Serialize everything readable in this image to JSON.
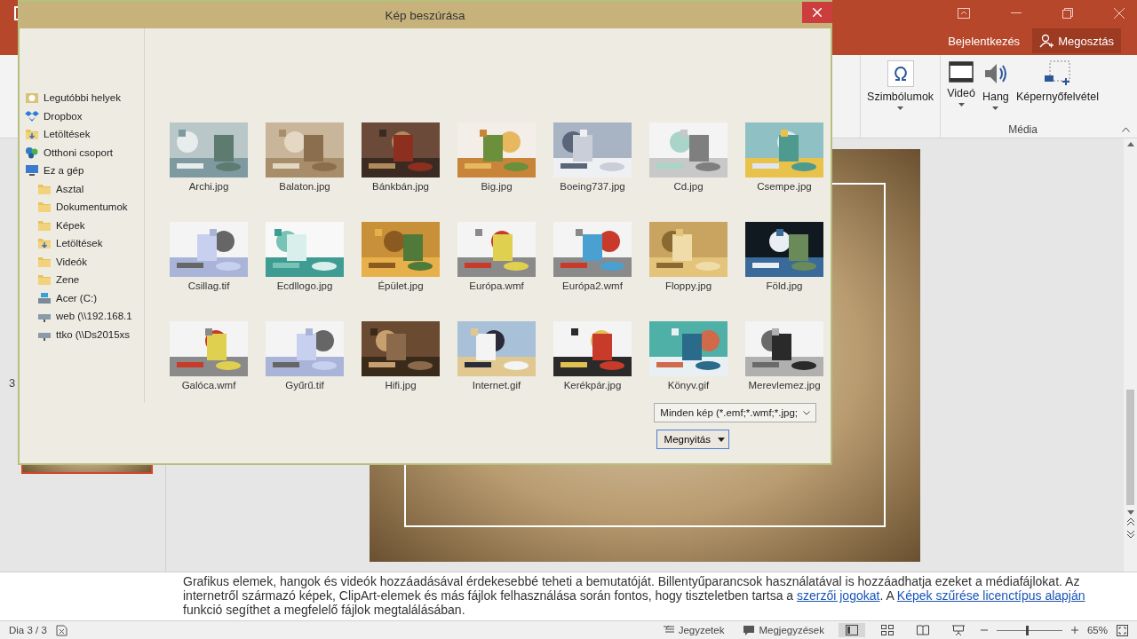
{
  "header": {
    "signin": "Bejelentkezés",
    "share": "Megosztás"
  },
  "ribbon": {
    "groups": [
      {
        "buttons": [
          {
            "label": "Szimbólumok",
            "kind": "symbol",
            "dropdown": true
          }
        ]
      },
      {
        "label": "Média",
        "buttons": [
          {
            "label": "Videó",
            "kind": "video",
            "dropdown": true
          },
          {
            "label": "Hang",
            "kind": "audio",
            "dropdown": true
          },
          {
            "label": "Képernyőfelvétel",
            "kind": "screen",
            "dropdown": false
          }
        ]
      }
    ]
  },
  "thumbnails": [
    {
      "number": "3",
      "selected": true
    }
  ],
  "notes": [
    {
      "text": "Grafikus elemek, hangok és videók hozzáadásával érdekesebbé teheti a bemutatóját. Billentyűparancsok használatával is hozzáadhatja ezeket a médiafájlokat. Az internetről származó képek, ClipArt-elemek és más fájlok felhasználása során fontos, hogy tiszteletben tartsa a ",
      "link": false
    },
    {
      "text": "szerzői jogokat",
      "link": true
    },
    {
      "text": ". A ",
      "link": false
    },
    {
      "text": "Képek szűrése licenctípus alapján",
      "link": true
    },
    {
      "text": " funkció segíthet a megfelelő fájlok megtalálásában.",
      "link": false
    }
  ],
  "status": {
    "slide": "Dia 3 / 3",
    "notes": "Jegyzetek",
    "comments": "Megjegyzések",
    "zoom": {
      "reading": "65%",
      "level": 0.45
    }
  },
  "dialog": {
    "title": "Kép beszúrása",
    "nav": [
      {
        "label": "Legutóbbi helyek",
        "kind": "recent"
      },
      {
        "label": "Dropbox",
        "kind": "dropbox"
      },
      {
        "label": "Letöltések",
        "kind": "download"
      },
      {
        "label": "Otthoni csoport",
        "kind": "homegroup"
      },
      {
        "label": "Ez a gép",
        "kind": "computer",
        "children": [
          {
            "label": "Asztal",
            "kind": "folder"
          },
          {
            "label": "Dokumentumok",
            "kind": "folder"
          },
          {
            "label": "Képek",
            "kind": "folder"
          },
          {
            "label": "Letöltések",
            "kind": "download"
          },
          {
            "label": "Videók",
            "kind": "folder"
          },
          {
            "label": "Zene",
            "kind": "folder"
          },
          {
            "label": "Acer (C:)",
            "kind": "drive"
          },
          {
            "label": "web (\\\\192.168.1",
            "kind": "network"
          },
          {
            "label": "ttko (\\\\Ds2015xs",
            "kind": "network"
          }
        ]
      }
    ],
    "files": [
      {
        "name": "Archi.jpg"
      },
      {
        "name": "Balaton.jpg"
      },
      {
        "name": "Bánkbán.jpg"
      },
      {
        "name": "Big.jpg"
      },
      {
        "name": "Boeing737.jpg"
      },
      {
        "name": "Cd.jpg"
      },
      {
        "name": "Csempe.jpg"
      },
      {
        "name": "Csillag.tif"
      },
      {
        "name": "Ecdllogo.jpg"
      },
      {
        "name": "Épület.jpg"
      },
      {
        "name": "Európa.wmf"
      },
      {
        "name": "Európa2.wmf"
      },
      {
        "name": "Floppy.jpg"
      },
      {
        "name": "Föld.jpg"
      },
      {
        "name": "Galóca.wmf"
      },
      {
        "name": "Gyűrű.tif"
      },
      {
        "name": "Hifi.jpg"
      },
      {
        "name": "Internet.gif"
      },
      {
        "name": "Kerékpár.jpg"
      },
      {
        "name": "Könyv.gif"
      },
      {
        "name": "Merevlemez.jpg"
      }
    ],
    "filter": "Minden kép (*.emf;*.wmf;*.jpg;",
    "open": "Megnyitás"
  }
}
